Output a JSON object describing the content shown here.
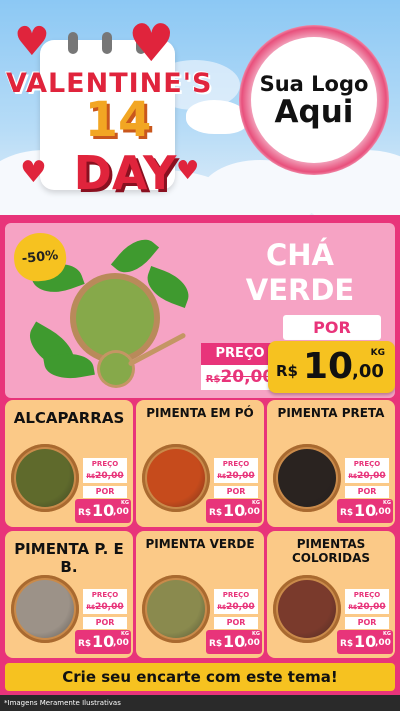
{
  "colors": {
    "accent": "#e8347a",
    "gold": "#f6c220",
    "card": "#fbc987",
    "sky": "#8cc8f4"
  },
  "header": {
    "title_line1": "VALENTINE'S",
    "title_number": "14",
    "title_line3": "DAY",
    "logo_line1": "Sua Logo",
    "logo_line2": "Aqui"
  },
  "featured": {
    "discount": "-50%",
    "name": "CHÁ VERDE",
    "por_label": "POR",
    "preco_label": "PREÇO",
    "old_currency": "R$",
    "old_price": "20,00",
    "currency": "R$",
    "price_int": "10",
    "price_dec": ",00",
    "unit": "KG",
    "icon": "green-tea-bowl-icon"
  },
  "products": [
    {
      "name": "ALCAPARRAS",
      "preco_label": "PREÇO",
      "old_currency": "R$",
      "old_price": "20,00",
      "por_label": "POR",
      "currency": "R$",
      "price_int": "10",
      "price_dec": ",00",
      "unit": "KG",
      "color": "#5f6a2c"
    },
    {
      "name": "PIMENTA EM PÓ",
      "preco_label": "PREÇO",
      "old_currency": "R$",
      "old_price": "20,00",
      "por_label": "POR",
      "currency": "R$",
      "price_int": "10",
      "price_dec": ",00",
      "unit": "KG",
      "color": "#c64b1c"
    },
    {
      "name": "PIMENTA PRETA",
      "preco_label": "PREÇO",
      "old_currency": "R$",
      "old_price": "20,00",
      "por_label": "POR",
      "currency": "R$",
      "price_int": "10",
      "price_dec": ",00",
      "unit": "KG",
      "color": "#2a2320"
    },
    {
      "name": "PIMENTA P. E B.",
      "preco_label": "PREÇO",
      "old_currency": "R$",
      "old_price": "20,00",
      "por_label": "POR",
      "currency": "R$",
      "price_int": "10",
      "price_dec": ",00",
      "unit": "KG",
      "color": "#9c9288"
    },
    {
      "name": "PIMENTA VERDE",
      "preco_label": "PREÇO",
      "old_currency": "R$",
      "old_price": "20,00",
      "por_label": "POR",
      "currency": "R$",
      "price_int": "10",
      "price_dec": ",00",
      "unit": "KG",
      "color": "#8a8a4e"
    },
    {
      "name": "PIMENTAS COLORIDAS",
      "preco_label": "PREÇO",
      "old_currency": "R$",
      "old_price": "20,00",
      "por_label": "POR",
      "currency": "R$",
      "price_int": "10",
      "price_dec": ",00",
      "unit": "KG",
      "color": "#7a3a2c"
    }
  ],
  "cta": "Crie seu encarte com este tema!",
  "footnote": "*Imagens Meramente Ilustrativas"
}
